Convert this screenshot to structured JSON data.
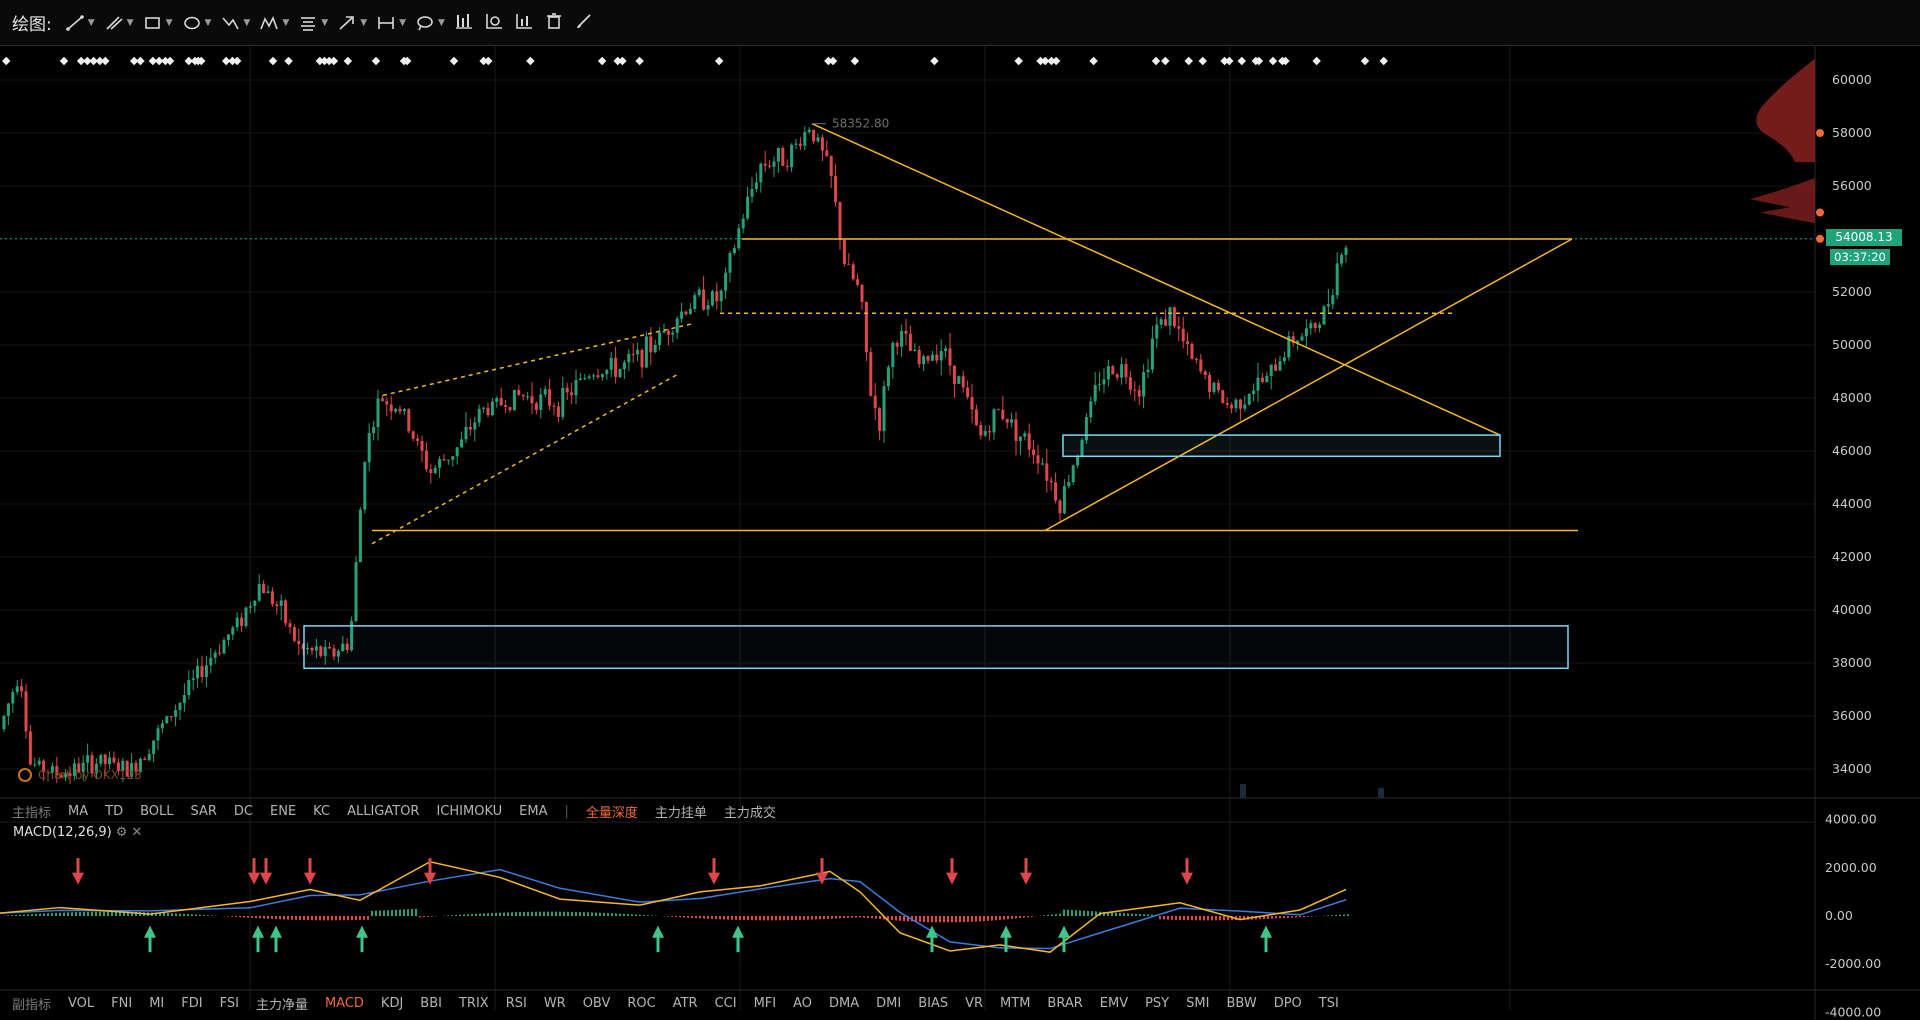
{
  "toolbar": {
    "label": "绘图:",
    "tools": [
      "line-tool",
      "pen-tool",
      "rectangle-tool",
      "circle-tool",
      "fib-tool",
      "pattern-tool",
      "text-tool",
      "arrow-tool",
      "measure-tool",
      "note-tool"
    ],
    "actions": [
      "bar-chart-icon",
      "chart-settings-icon",
      "column-icon",
      "trash-icon",
      "brush-icon"
    ]
  },
  "price_axis": {
    "labels": [
      "60000",
      "58000",
      "56000",
      "54000",
      "52000",
      "50000",
      "48000",
      "46000",
      "44000",
      "42000",
      "40000",
      "38000",
      "36000",
      "34000"
    ],
    "current_price": "54008.13",
    "countdown": "03:37:20"
  },
  "annotation": {
    "high_label": "58352.80"
  },
  "watermark": "Chart by OKX123",
  "main_indicator_bar": {
    "group_label": "主指标",
    "items": [
      "MA",
      "TD",
      "BOLL",
      "SAR",
      "DC",
      "ENE",
      "KC",
      "ALLIGATOR",
      "ICHIMOKU",
      "EMA"
    ],
    "extra": [
      "全量深度",
      "主力挂单",
      "主力成交"
    ]
  },
  "macd": {
    "title": "MACD(12,26,9)",
    "axis_labels": [
      "4000.00",
      "2000.00",
      "0.00",
      "-2000.00",
      "-4000.00"
    ]
  },
  "sub_indicator_bar": {
    "group_label": "副指标",
    "items": [
      "VOL",
      "FNI",
      "MI",
      "FDI",
      "FSI",
      "主力净量",
      "MACD",
      "KDJ",
      "BBI",
      "TRIX",
      "RSI",
      "WR",
      "OBV",
      "ROC",
      "ATR",
      "CCI",
      "MFI",
      "AO",
      "DMA",
      "DMI",
      "BIAS",
      "VR",
      "MTM",
      "BRAR",
      "EMV",
      "PSY",
      "SMI",
      "BBW",
      "DPO",
      "TSI"
    ],
    "active": "MACD"
  },
  "colors": {
    "up": "#26a17b",
    "down": "#e0474c",
    "drawing": "#f5b729",
    "box": "#7fd4f7",
    "accent": "#f06a3a",
    "dif": "#f5b729",
    "dea": "#3a7bdc"
  }
}
